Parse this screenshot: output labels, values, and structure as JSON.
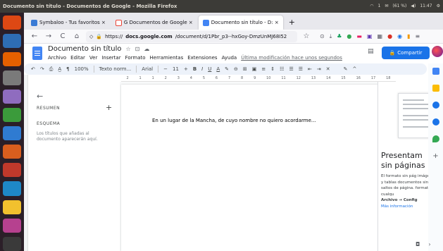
{
  "window": {
    "title": "Documento sin título - Documentos de Google - Mozilla Firefox"
  },
  "system": {
    "wifi": "wifi-icon",
    "indicator": "1",
    "mail": "mail-icon",
    "battery": "(61 %)",
    "volume": "volume-icon",
    "time": "11:47",
    "settings": "gear-icon"
  },
  "launcher": [
    {
      "name": "ubuntu-menu-icon",
      "color": "#dd4814"
    },
    {
      "name": "files-icon",
      "color": "#2e6db4"
    },
    {
      "name": "firefox-icon",
      "color": "#e66000"
    },
    {
      "name": "archive-icon",
      "color": "#7a7a7a"
    },
    {
      "name": "disks-icon",
      "color": "#8f6cbf"
    },
    {
      "name": "spreadsheet-icon",
      "color": "#3b9b3b"
    },
    {
      "name": "document-icon",
      "color": "#2f7bd1"
    },
    {
      "name": "presentation-icon",
      "color": "#d95e1e"
    },
    {
      "name": "software-center-icon",
      "color": "#c0392b"
    },
    {
      "name": "help-icon",
      "color": "#1e88c7"
    },
    {
      "name": "notes-icon",
      "color": "#f2c12e"
    },
    {
      "name": "amazon-icon",
      "color": "#b6418f"
    },
    {
      "name": "terminal-icon",
      "color": "#3a3a3a"
    }
  ],
  "tabs": [
    {
      "label": "Symbaloo - Tus favoritos ×",
      "color": "#3a7bd5",
      "active": false
    },
    {
      "label": "G  Documentos de Google ×",
      "color": "#ea4335",
      "active": false
    },
    {
      "label": "Documento sin título - D: ×",
      "color": "#4285f4",
      "active": true
    }
  ],
  "newtab": "+",
  "nav": {
    "url_host": "docs.google.com",
    "url_prefix": "https://",
    "url_path": "/document/d/1Pbr_p3--hxGoy-DmzUnMJ68I52",
    "back": "←",
    "forward": "→",
    "reload": "C",
    "home": "⌂"
  },
  "doc": {
    "title": "Documento sin título",
    "menus": [
      "Archivo",
      "Editar",
      "Ver",
      "Insertar",
      "Formato",
      "Herramientas",
      "Extensiones",
      "Ayuda"
    ],
    "last_edit": "Última modificación hace unos segundos",
    "share": "Compartir"
  },
  "toolbar": {
    "zoom": "100%",
    "style": "Texto norm...",
    "font": "Arial",
    "size": "11",
    "bold": "B",
    "italic": "I",
    "underline": "U",
    "color": "A"
  },
  "ruler": [
    "2",
    "1",
    "1",
    "2",
    "3",
    "4",
    "5",
    "6",
    "7",
    "8",
    "9",
    "10",
    "11",
    "12",
    "13",
    "14",
    "15",
    "16",
    "17",
    "18"
  ],
  "outline": {
    "back": "←",
    "resumen": "RESUMEN",
    "add": "+",
    "esquema": "ESQUEMA",
    "hint": "Los títulos que añadas al documento aparecerán aquí."
  },
  "page": {
    "text": "En un lugar de la Mancha, de cuyo nombre no quiero acordarme..."
  },
  "sidepanel": {
    "title_line1": "Presentam",
    "title_line2": "sin páginas",
    "body": "El formato sin pág imágenes y tablas documentos sin lí saltos de página. formato de cualqu",
    "path": "Archivo → Config",
    "more": "Más información"
  }
}
